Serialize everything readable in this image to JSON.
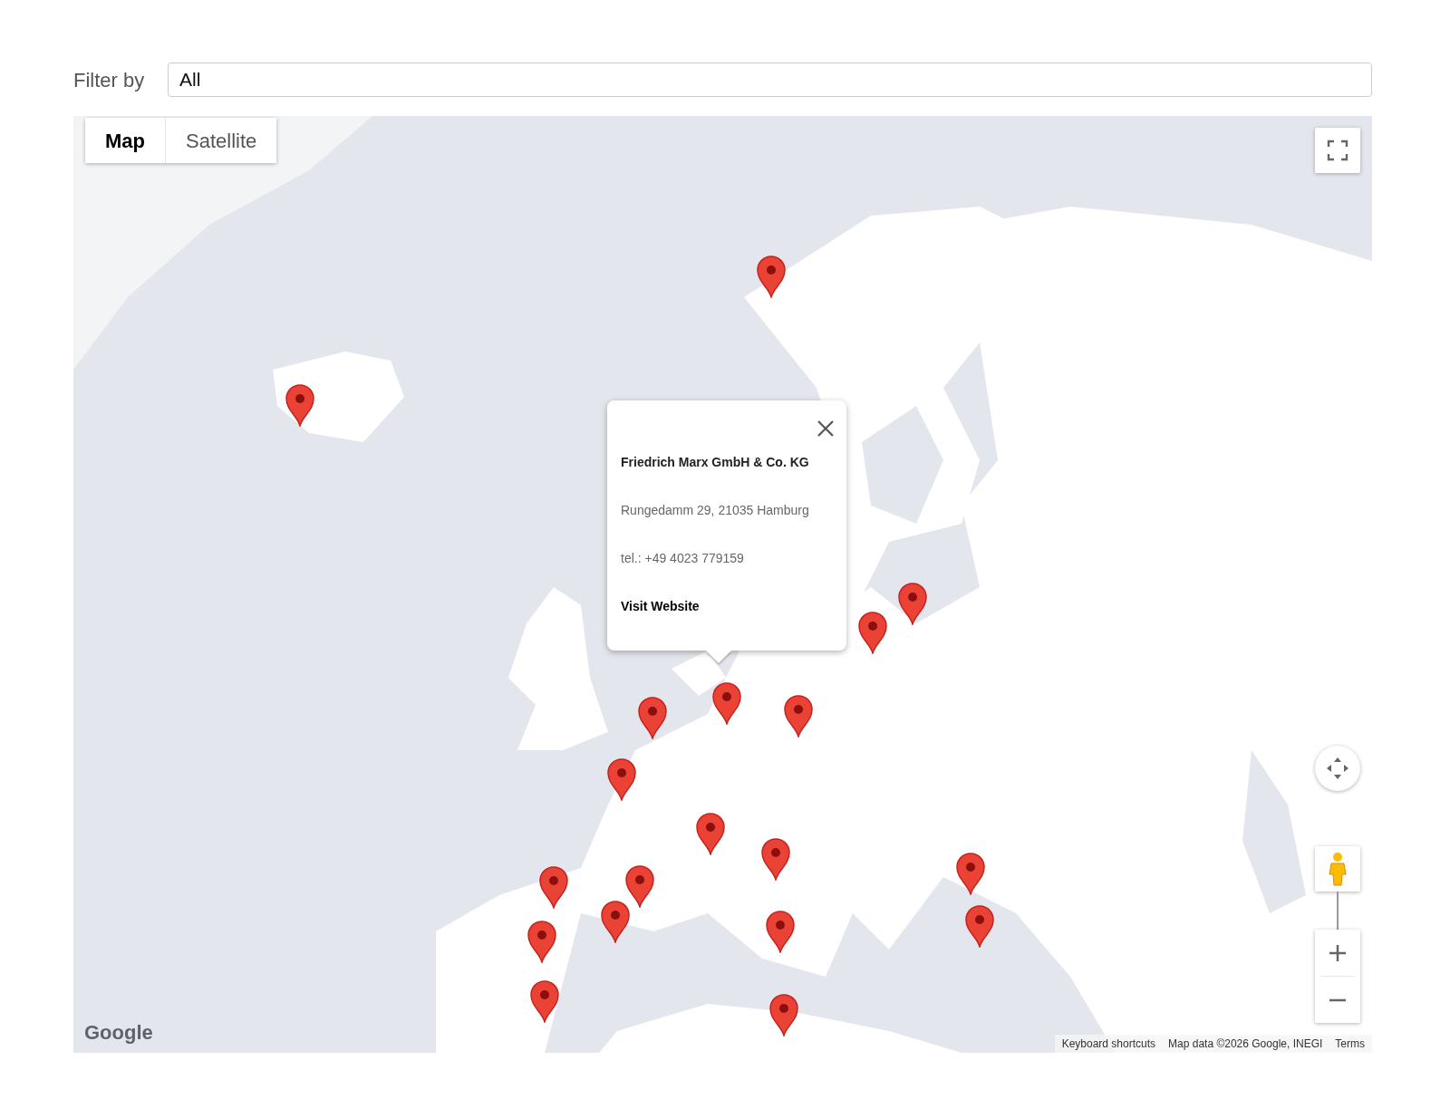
{
  "filter": {
    "label": "Filter by",
    "value": "All"
  },
  "map": {
    "kind": "picture",
    "map_types": [
      {
        "label": "Map",
        "selected": true
      },
      {
        "label": "Satellite",
        "selected": false
      }
    ],
    "info_window": {
      "title": "Friedrich Marx GmbH & Co. KG",
      "address": "Rungedamm 29, 21035 Hamburg",
      "phone": "tel.: +49 4023 779159",
      "link": "Visit Website"
    },
    "logo": "Google",
    "footer": [
      "Keyboard shortcuts",
      "Map data ©2026 Google, INEGI",
      "Terms"
    ]
  }
}
